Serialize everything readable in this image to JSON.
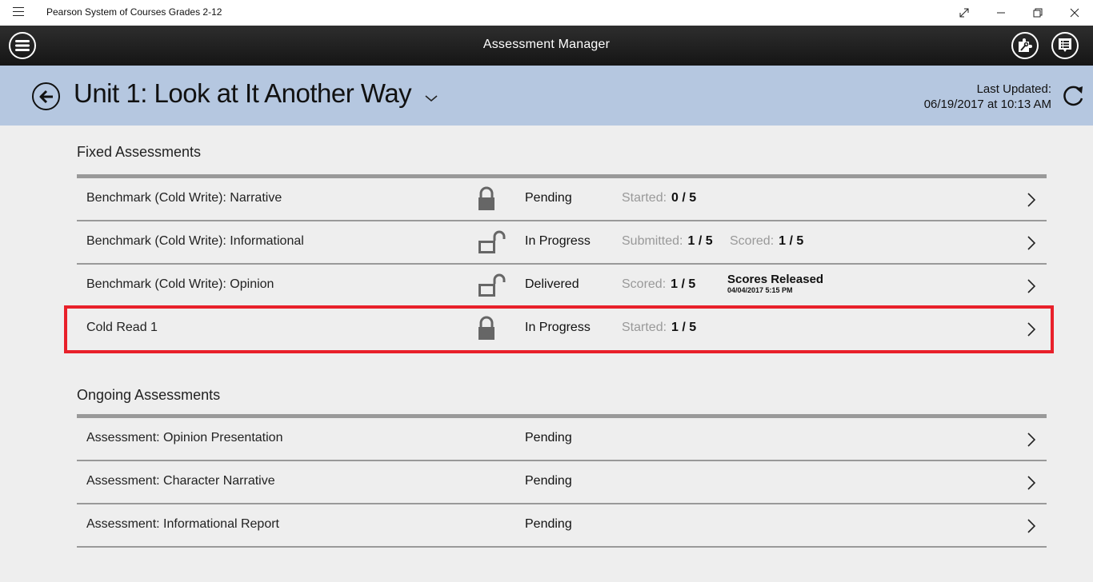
{
  "window": {
    "title": "Pearson System of Courses Grades 2-12",
    "controls": [
      "fullscreen-icon",
      "minimize-icon",
      "restore-icon",
      "close-icon"
    ]
  },
  "appbar": {
    "title": "Assessment Manager",
    "left_icon": "menu-icon",
    "right_icons": [
      "puzzle-tools-icon",
      "list-comment-icon"
    ]
  },
  "header": {
    "unit_title": "Unit 1: Look at It Another Way",
    "last_updated_label": "Last Updated:",
    "last_updated_value": "06/19/2017 at 10:13 AM"
  },
  "fixed": {
    "title": "Fixed Assessments",
    "rows": [
      {
        "name": "Benchmark (Cold Write): Narrative",
        "lock": "locked",
        "status": "Pending",
        "stats": [
          {
            "label": "Started:",
            "value": "0 / 5"
          }
        ]
      },
      {
        "name": "Benchmark (Cold Write): Informational",
        "lock": "unlocked",
        "status": "In Progress",
        "stats": [
          {
            "label": "Submitted:",
            "value": "1 / 5"
          },
          {
            "label": "Scored:",
            "value": "1 / 5"
          }
        ]
      },
      {
        "name": "Benchmark (Cold Write): Opinion",
        "lock": "unlocked",
        "status": "Delivered",
        "stats": [
          {
            "label": "Scored:",
            "value": "1 / 5"
          }
        ],
        "released": {
          "title": "Scores Released",
          "date": "04/04/2017 5:15 PM"
        }
      },
      {
        "name": "Cold Read 1",
        "lock": "locked",
        "status": "In Progress",
        "highlighted": true,
        "stats": [
          {
            "label": "Started:",
            "value": "1 / 5"
          }
        ]
      }
    ]
  },
  "ongoing": {
    "title": "Ongoing Assessments",
    "rows": [
      {
        "name": "Assessment: Opinion Presentation",
        "status": "Pending"
      },
      {
        "name": "Assessment: Character Narrative",
        "status": "Pending"
      },
      {
        "name": "Assessment: Informational Report",
        "status": "Pending"
      }
    ]
  },
  "colors": {
    "header_bg": "#b5c7e0",
    "highlight": "#e8202a",
    "rule": "#999999",
    "label_gray": "#999999"
  }
}
